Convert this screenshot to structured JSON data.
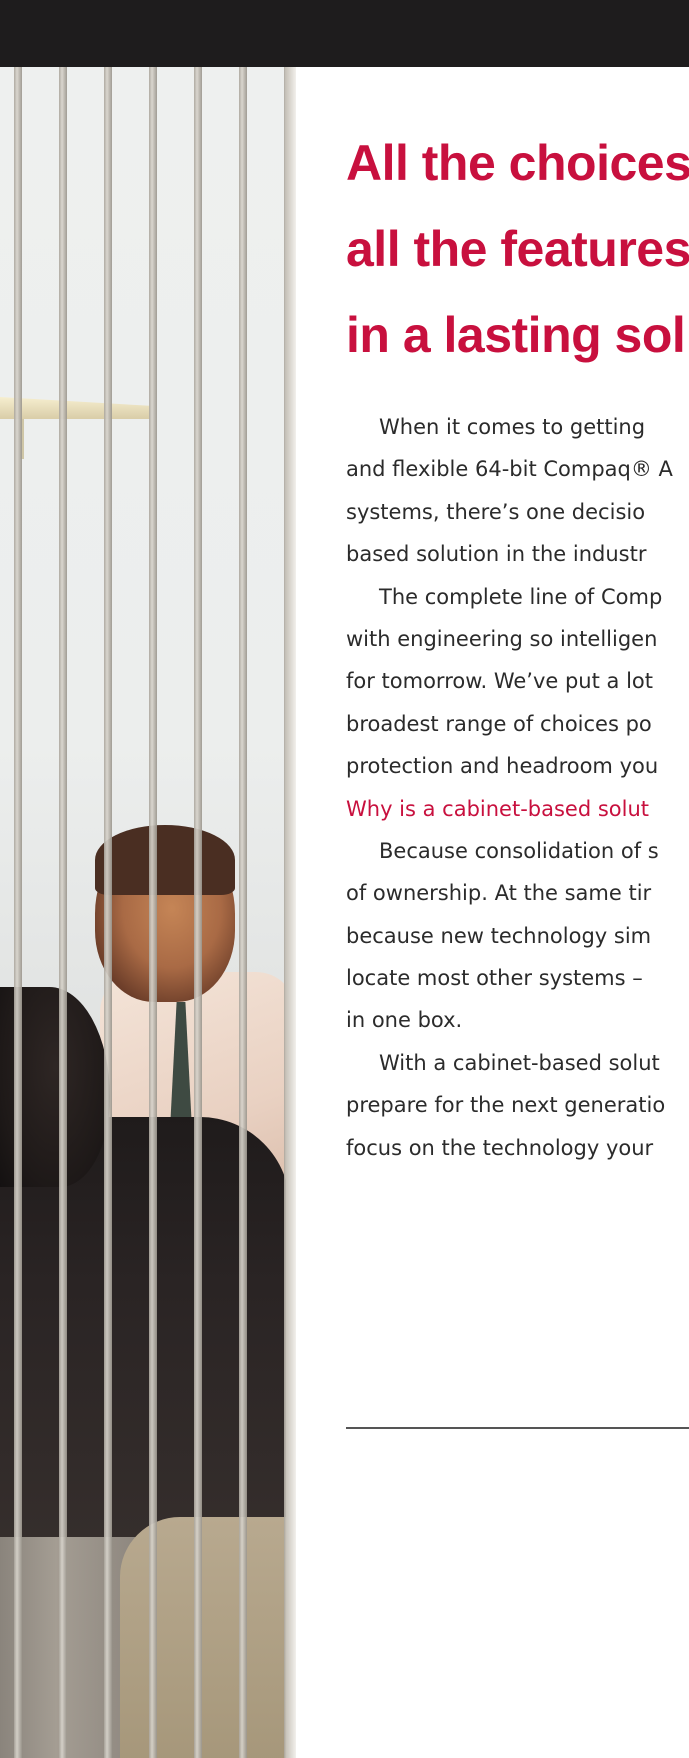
{
  "headline": {
    "lines": [
      "All the choices",
      "all the features",
      "in a lasting sol"
    ]
  },
  "body": {
    "lines": [
      "When it comes to getting",
      "and flexible 64-bit Compaq® A",
      "systems, there’s one decisio",
      "based solution in the industr",
      "The complete line of Comp",
      "with engineering so intelligen",
      "for tomorrow. We’ve put a lot",
      "broadest range of choices po",
      "protection and headroom you",
      "Why is a cabinet-based solut",
      "Because consolidation of s",
      "of ownership. At the same tir",
      "because new technology sim",
      "locate most other systems –",
      "in one box.",
      "With a cabinet-based solut",
      "prepare for the next generatio",
      "focus on the technology your"
    ]
  },
  "colors": {
    "accent": "#c8103e",
    "text": "#2b2b2b",
    "top_bar": "#1e1c1d"
  }
}
